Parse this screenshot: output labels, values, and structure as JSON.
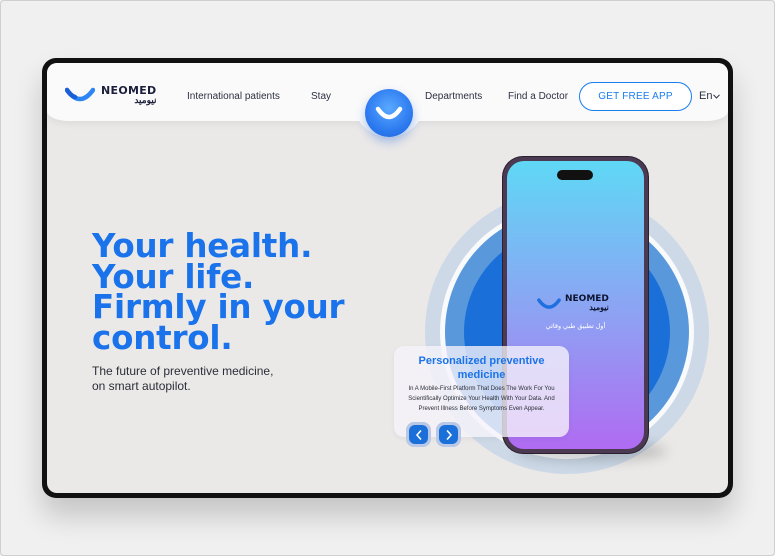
{
  "brand": {
    "name_en": "NEOMED",
    "name_ar": "نيوميد",
    "accent": "#1a73ea"
  },
  "nav": {
    "links": [
      "International patients",
      "Stay",
      "Departments",
      "Find a Doctor"
    ],
    "cta_label": "GET FREE APP",
    "language": "En"
  },
  "hero": {
    "title_lines": [
      "Your health.",
      "Your life.",
      "Firmly in your",
      "control."
    ],
    "subtitle_lines": [
      "The future of preventive medicine,",
      "on smart autopilot."
    ]
  },
  "phone": {
    "tagline_ar": "أول تطبيق طبي وقائي"
  },
  "card": {
    "title": "Personalized preventive medicine",
    "body": "In A Mobile-First Platform That Does The Work For You Scientifically Optimize Your Health With Your Data. And Prevent Illness Before Symptoms Even Appear."
  },
  "icons": {
    "logo": "smile-logo-icon",
    "center": "smile-badge-icon",
    "language": "chevron-down-icon",
    "prev": "chevron-left-icon",
    "next": "chevron-right-icon"
  }
}
